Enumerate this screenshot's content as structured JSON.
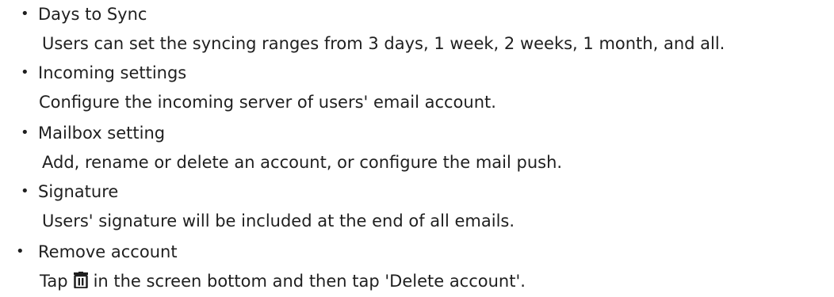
{
  "items": [
    {
      "bullet": "•",
      "title": "Days to Sync",
      "description": "Users can set the syncing ranges from 3 days, 1 week, 2 weeks, 1 month, and all."
    },
    {
      "bullet": "•",
      "title": "Incoming settings",
      "description": "Configure the incoming server of users' email account."
    },
    {
      "bullet": "•",
      "title": "Mailbox setting",
      "description": "Add, rename or delete an account, or configure the mail push."
    },
    {
      "bullet": "•",
      "title": "Signature",
      "description": "Users' signature will be included at the end of all emails."
    },
    {
      "bullet": "•",
      "title": "Remove account",
      "description_before_icon": "Tap",
      "icon": "trash-icon",
      "description_after_icon": "in the screen bottom and then tap 'Delete account'."
    }
  ]
}
